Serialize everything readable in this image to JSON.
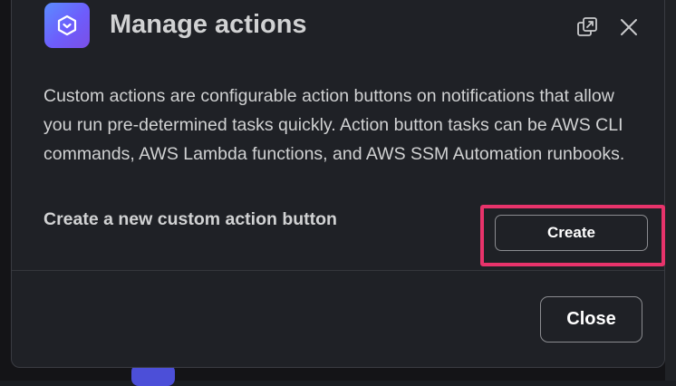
{
  "modal": {
    "title": "Manage actions",
    "app_icon": "aws-chatbot-icon",
    "popout_icon": "popout-icon",
    "close_icon": "close-icon",
    "description": "Custom actions are configurable action buttons on notifications that allow you run pre-determined tasks quickly.  Action button tasks can be AWS CLI commands, AWS Lambda functions, and AWS SSM Automation runbooks.",
    "create_label": "Create a new custom action button",
    "create_button": "Create",
    "close_button": "Close"
  },
  "colors": {
    "highlight": "#e8336b",
    "icon_gradient_start": "#5b8cff",
    "icon_gradient_end": "#7b4fe6",
    "modal_bg": "#1f2126",
    "text": "#d1d2d3"
  }
}
